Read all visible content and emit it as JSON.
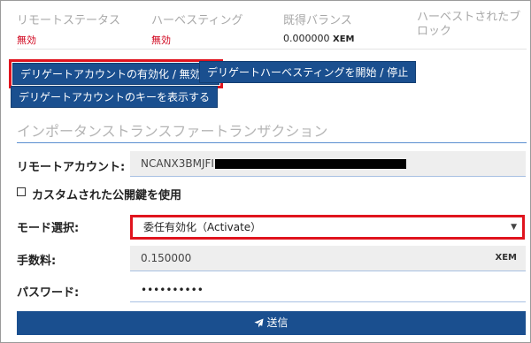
{
  "status": {
    "remote_status": {
      "label": "リモートステータス",
      "value": "無効"
    },
    "harvesting": {
      "label": "ハーベスティング",
      "value": "無効"
    },
    "vested_balance": {
      "label": "既得バランス",
      "amount": "0.000000",
      "unit": "XEM"
    },
    "harvested_blocks": {
      "label": "ハーベストされたブロック"
    },
    "colors": {
      "inactive": "#d0021b",
      "accent": "#1a4f8f",
      "highlight": "#e0141e"
    }
  },
  "buttons": {
    "toggle_delegated": "デリゲートアカウントの有効化 / 無効化",
    "delegated_harvest": "デリゲートハーベスティングを開始 / 停止",
    "show_delegated_key": "デリゲートアカウントのキーを表示する"
  },
  "importance_transfer": {
    "title": "インポータンストランスファートランザクション",
    "remote_account": {
      "label": "リモートアカウント:",
      "value": "NCANX3BMJFI"
    },
    "custom_key": {
      "label": "カスタムされた公開鍵を使用"
    },
    "mode": {
      "label": "モード選択:",
      "selected": "委任有効化（Activate）"
    },
    "fee": {
      "label": "手数料:",
      "value": "0.150000",
      "unit": "XEM"
    },
    "password": {
      "label": "パスワード:",
      "value": "••••••••••"
    },
    "send": {
      "label": "送信",
      "icon": "paper-plane-icon"
    }
  }
}
